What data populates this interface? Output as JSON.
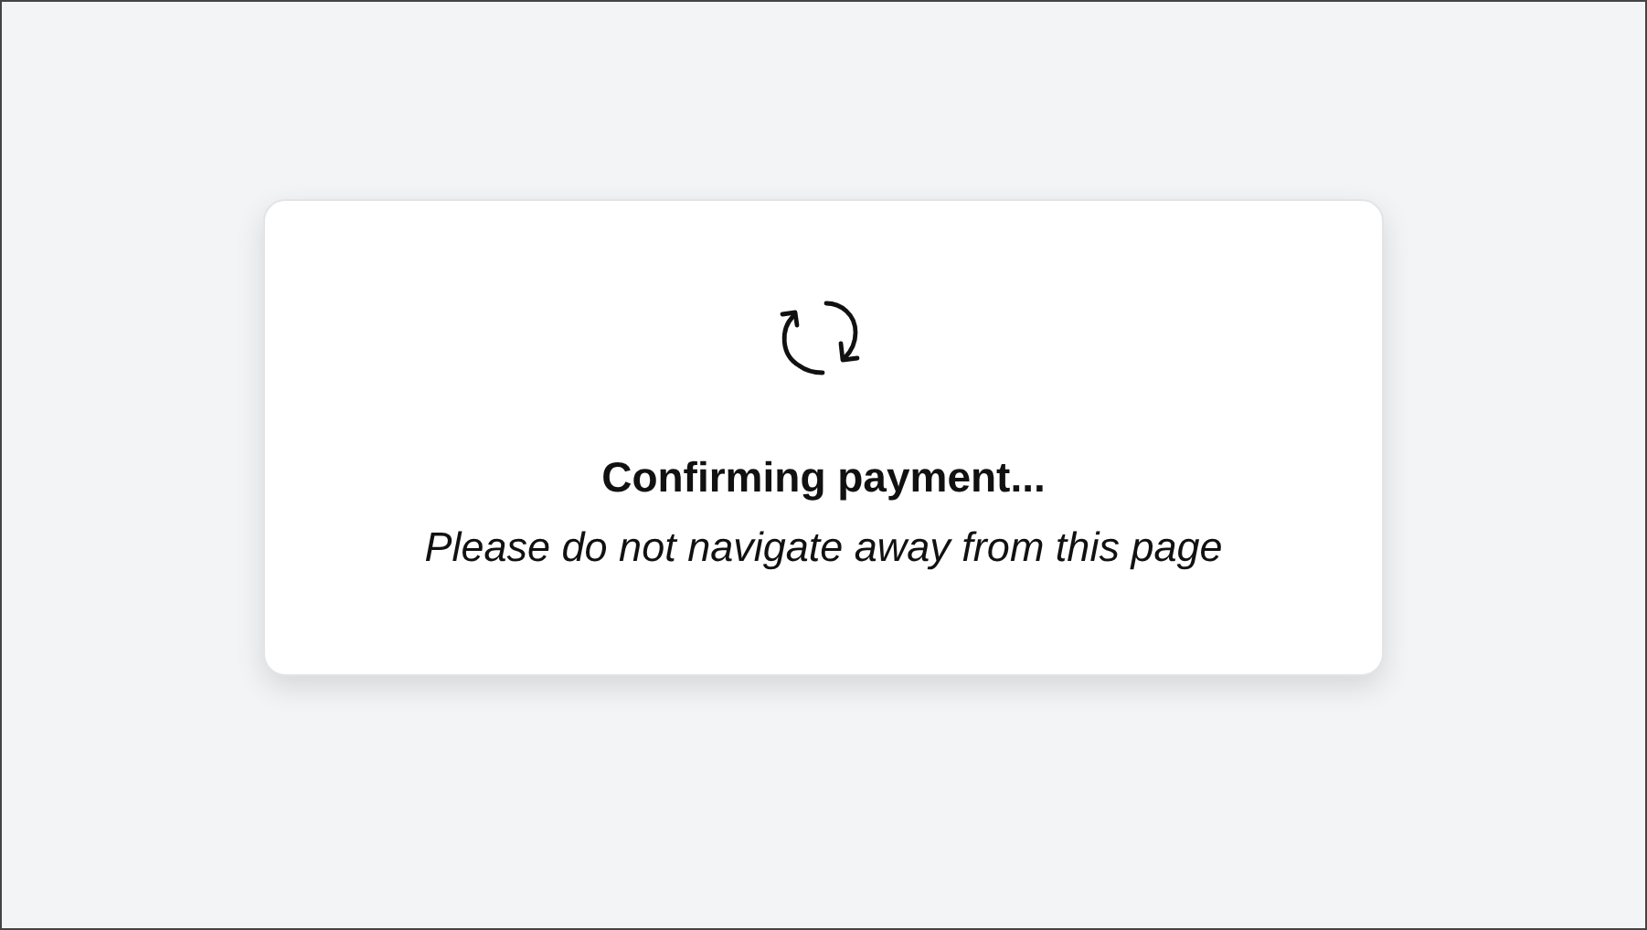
{
  "dialog": {
    "title": "Confirming payment...",
    "message": "Please do not navigate away from this page"
  }
}
